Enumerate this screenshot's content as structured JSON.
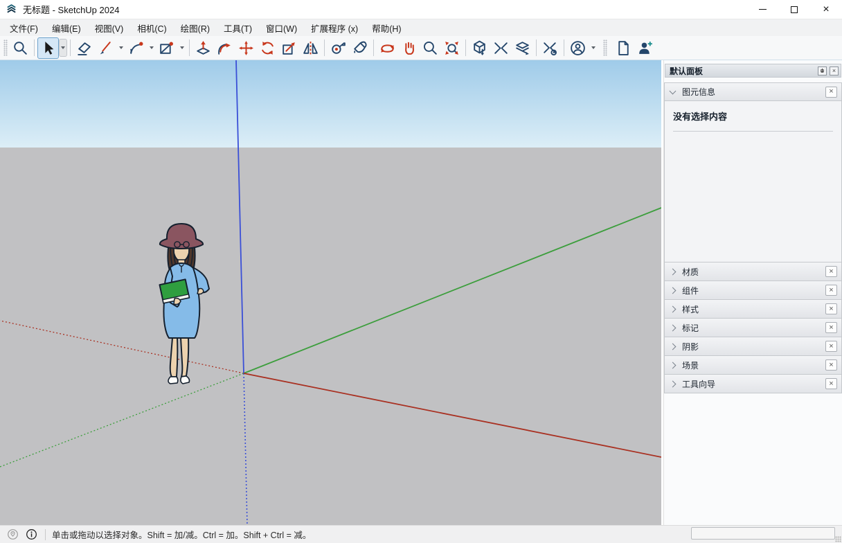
{
  "window": {
    "title": "无标题 - SketchUp 2024",
    "controls": {
      "minimize": "minimize",
      "maximize": "maximize",
      "close_glyph": "×"
    }
  },
  "menu": {
    "items": [
      "文件(F)",
      "编辑(E)",
      "视图(V)",
      "相机(C)",
      "绘图(R)",
      "工具(T)",
      "窗口(W)",
      "扩展程序 (x)",
      "帮助(H)"
    ]
  },
  "toolbar": {
    "tools": [
      "search",
      "select",
      "eraser",
      "line",
      "arc",
      "shapes",
      "push-pull",
      "follow-me",
      "move",
      "rotate",
      "scale",
      "flip",
      "tape-measure",
      "paint-bucket",
      "orbit",
      "pan",
      "zoom",
      "zoom-extents",
      "3d-warehouse",
      "extension-warehouse",
      "send-to-layout",
      "extension-manager",
      "account",
      "new-file",
      "invite"
    ],
    "active_tool": "select"
  },
  "panel": {
    "title": "默认面板",
    "entity_info": {
      "label": "图元信息",
      "empty_text": "没有选择内容"
    },
    "sections": [
      {
        "label": "材质"
      },
      {
        "label": "组件"
      },
      {
        "label": "样式"
      },
      {
        "label": "标记"
      },
      {
        "label": "阴影"
      },
      {
        "label": "场景"
      },
      {
        "label": "工具向导"
      }
    ],
    "close_glyph": "×"
  },
  "statusbar": {
    "hint": "单击或拖动以选择对象。Shift = 加/减。Ctrl = 加。Shift + Ctrl = 减。",
    "measurement_value": ""
  },
  "colors": {
    "sky_top": "#9fcbe9",
    "sky_horizon": "#dceef7",
    "ground": "#c1c1c3",
    "axis_red": "#a93122",
    "axis_green": "#3c9e3c",
    "axis_blue": "#3a4fd7",
    "icon_navy": "#24466b",
    "icon_red": "#c8381d",
    "select_highlight": "#d5e7f6"
  }
}
